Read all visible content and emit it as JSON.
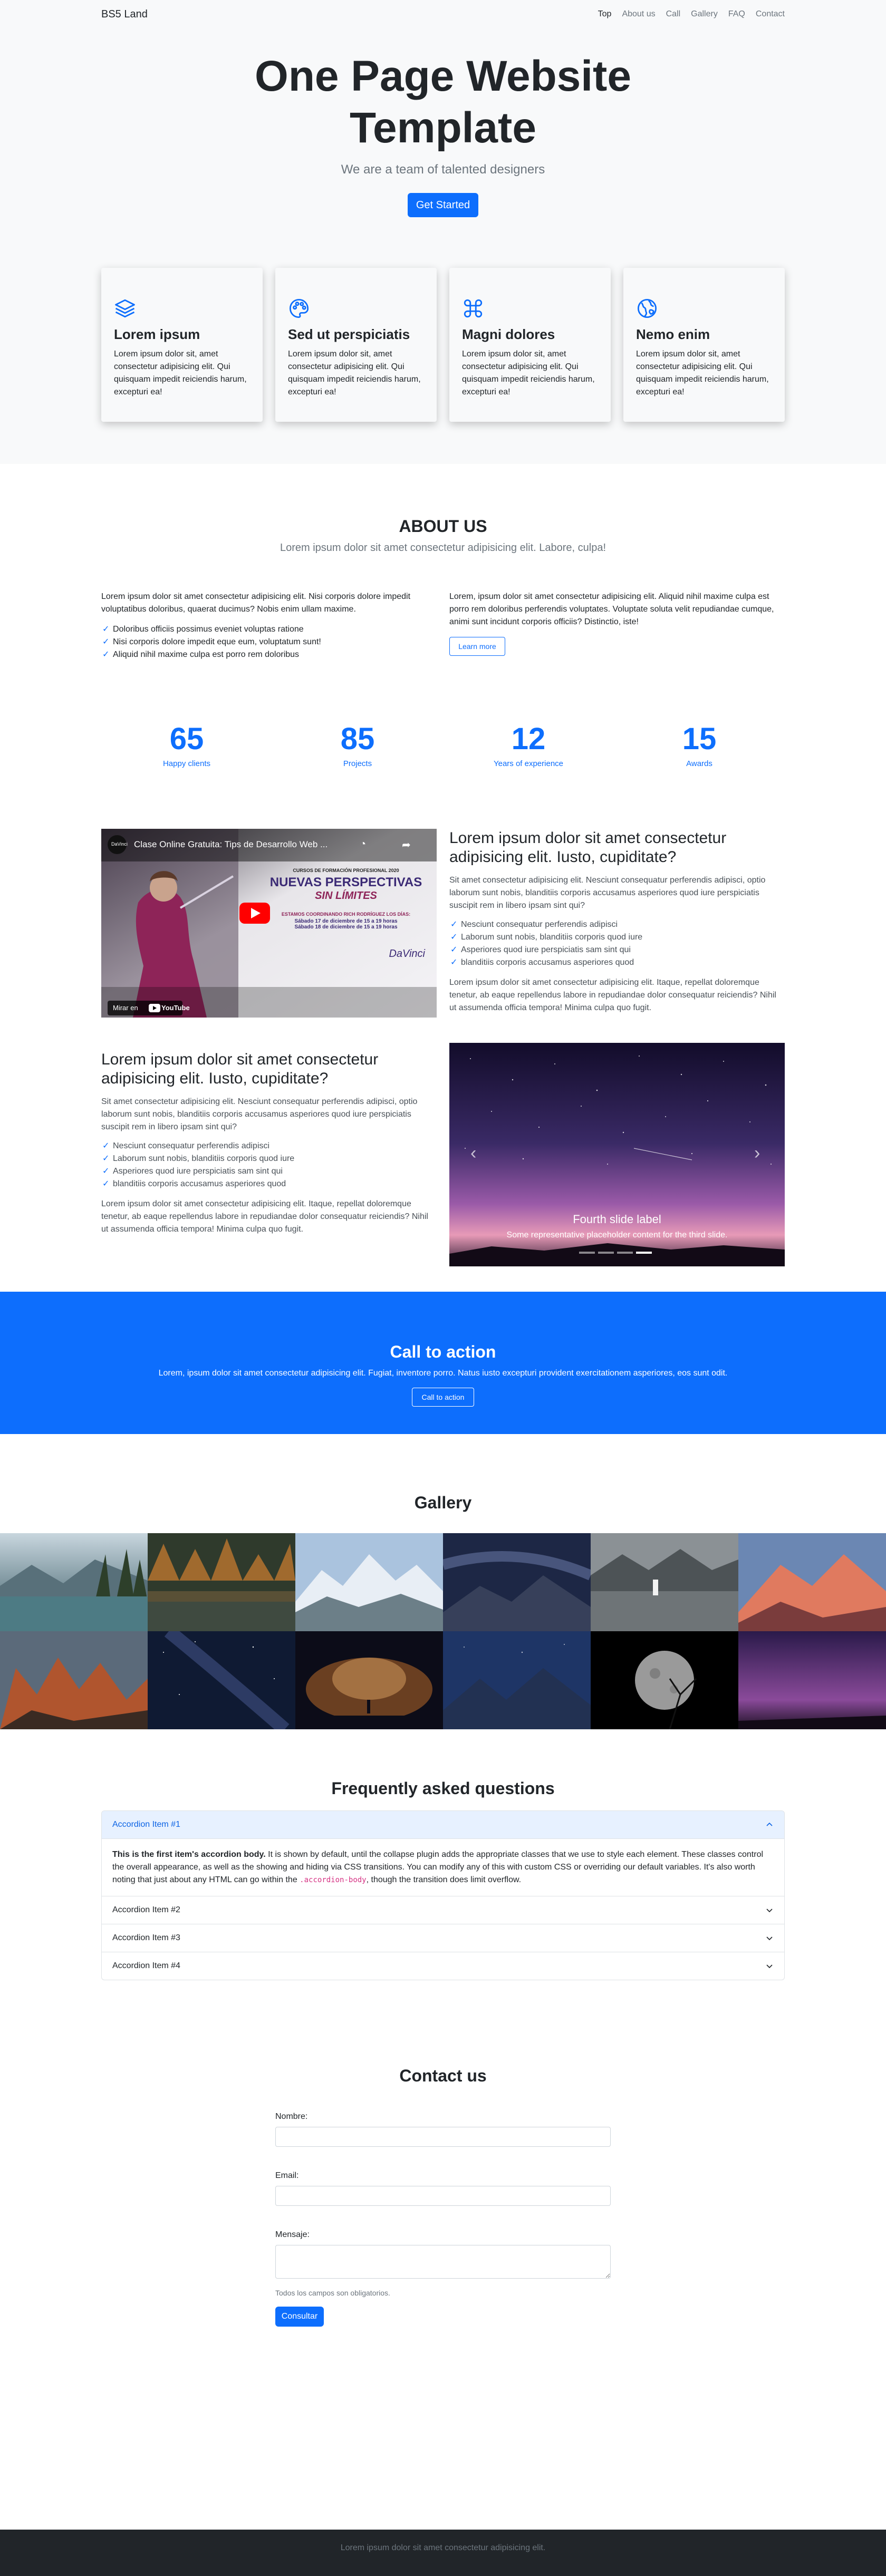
{
  "nav": {
    "brand": "BS5 Land",
    "links": [
      "Top",
      "About us",
      "Call",
      "Gallery",
      "FAQ",
      "Contact"
    ]
  },
  "hero": {
    "title": "One Page Website Template",
    "subtitle": "We are a team of talented designers",
    "button": "Get Started"
  },
  "features": [
    {
      "icon": "layers-icon",
      "title": "Lorem ipsum",
      "text": "Lorem ipsum dolor sit, amet consectetur adipisicing elit. Qui quisquam impedit reiciendis harum, excepturi ea!"
    },
    {
      "icon": "palette-icon",
      "title": "Sed ut perspiciatis",
      "text": "Lorem ipsum dolor sit, amet consectetur adipisicing elit. Qui quisquam impedit reiciendis harum, excepturi ea!"
    },
    {
      "icon": "command-icon",
      "title": "Magni dolores",
      "text": "Lorem ipsum dolor sit, amet consectetur adipisicing elit. Qui quisquam impedit reiciendis harum, excepturi ea!"
    },
    {
      "icon": "globe-icon",
      "title": "Nemo enim",
      "text": "Lorem ipsum dolor sit, amet consectetur adipisicing elit. Qui quisquam impedit reiciendis harum, excepturi ea!"
    }
  ],
  "about": {
    "title": "ABOUT US",
    "lead": "Lorem ipsum dolor sit amet consectetur adipisicing elit. Labore, culpa!",
    "left_text": "Lorem ipsum dolor sit amet consectetur adipisicing elit. Nisi corporis dolore impedit voluptatibus doloribus, quaerat ducimus? Nobis enim ullam maxime.",
    "left_checks": [
      "Doloribus officiis possimus eveniet voluptas ratione",
      "Nisi corporis dolore impedit eque eum, voluptatum sunt!",
      "Aliquid nihil maxime culpa est porro rem doloribus"
    ],
    "right_text": "Lorem, ipsum dolor sit amet consectetur adipisicing elit. Aliquid nihil maxime culpa est porro rem doloribus perferendis voluptates. Voluptate soluta velit repudiandae cumque, animi sunt incidunt corporis officiis? Distinctio, iste!",
    "learn_more": "Learn more"
  },
  "stats": [
    {
      "value": "65",
      "label": "Happy clients"
    },
    {
      "value": "85",
      "label": "Projects"
    },
    {
      "value": "12",
      "label": "Years of experience"
    },
    {
      "value": "15",
      "label": "Awards"
    }
  ],
  "video": {
    "channel": "DaVinci",
    "title": "Clase Online Gratuita: Tips de Desarrollo Web ...",
    "watch_label": "Mirar en",
    "platform": "YouTube",
    "poster_header": "CURSOS DE FORMACIÓN PROFESIONAL 2020",
    "poster_title": "NUEVAS PERSPECTIVAS",
    "poster_subtitle": "SIN LÍMITES",
    "poster_line1": "ESTAMOS COORDINANDO RICH RODRÍGUEZ LOS DÍAS:",
    "poster_line2": "Sábado 17 de diciembre de 15 a 19 horas",
    "poster_line3": "Sábado 18 de diciembre de 15 a 19 horas",
    "poster_brand": "DaVinci"
  },
  "row1": {
    "heading": "Lorem ipsum dolor sit amet consectetur adipisicing elit. Iusto, cupiditate?",
    "text1": "Sit amet consectetur adipisicing elit. Nesciunt consequatur perferendis adipisci, optio laborum sunt nobis, blanditiis corporis accusamus asperiores quod iure perspiciatis suscipit rem in libero ipsam sint qui?",
    "checks": [
      "Nesciunt consequatur perferendis adipisci",
      "Laborum sunt nobis, blanditiis corporis quod iure",
      "Asperiores quod iure perspiciatis sam sint qui",
      "blanditiis corporis accusamus asperiores quod"
    ],
    "text2": "Lorem ipsum dolor sit amet consectetur adipisicing elit. Itaque, repellat doloremque tenetur, ab eaque repellendus labore in repudiandae dolor consequatur reiciendis? Nihil ut assumenda officia tempora! Minima culpa quo fugit."
  },
  "row2": {
    "heading": "Lorem ipsum dolor sit amet consectetur adipisicing elit. Iusto, cupiditate?",
    "text1": "Sit amet consectetur adipisicing elit. Nesciunt consequatur perferendis adipisci, optio laborum sunt nobis, blanditiis corporis accusamus asperiores quod iure perspiciatis suscipit rem in libero ipsam sint qui?",
    "checks": [
      "Nesciunt consequatur perferendis adipisci",
      "Laborum sunt nobis, blanditiis corporis quod iure",
      "Asperiores quod iure perspiciatis sam sint qui",
      "blanditiis corporis accusamus asperiores quod"
    ],
    "text2": "Lorem ipsum dolor sit amet consectetur adipisicing elit. Itaque, repellat doloremque tenetur, ab eaque repellendus labore in repudiandae dolor consequatur reiciendis? Nihil ut assumenda officia tempora! Minima culpa quo fugit."
  },
  "carousel": {
    "caption_title": "Fourth slide label",
    "caption_text": "Some representative placeholder content for the third slide.",
    "slides": 4,
    "active_slide": 4
  },
  "cta": {
    "title": "Call to action",
    "text": "Lorem, ipsum dolor sit amet consectetur adipisicing elit. Fugiat, inventore porro. Natus iusto excepturi provident exercitationem asperiores, eos sunt odit.",
    "button": "Call to action"
  },
  "gallery": {
    "title": "Gallery",
    "tiles": [
      "lake-forest",
      "autumn-lake",
      "snowy-mountains",
      "milky-way-mountain",
      "misty-lake",
      "pink-peaks",
      "orange-rocks",
      "starry-night",
      "galaxy-silhouette",
      "night-peaks",
      "moon-branch",
      "purple-sky"
    ]
  },
  "faq": {
    "title": "Frequently asked questions",
    "items": [
      "Accordion Item #1",
      "Accordion Item #2",
      "Accordion Item #3",
      "Accordion Item #4"
    ],
    "body_strong": "This is the first item's accordion body.",
    "body_text": " It is shown by default, until the collapse plugin adds the appropriate classes that we use to style each element. These classes control the overall appearance, as well as the showing and hiding via CSS transitions. You can modify any of this with custom CSS or overriding our default variables. It's also worth noting that just about any HTML can go within the ",
    "body_code": ".accordion-body",
    "body_end": ", though the transition does limit overflow."
  },
  "contact": {
    "title": "Contact us",
    "name_label": "Nombre:",
    "email_label": "Email:",
    "message_label": "Mensaje:",
    "help": "Todos los campos son obligatorios.",
    "submit": "Consultar"
  },
  "footer": {
    "text": "Lorem ipsum dolor sit amet consectetur adipisicing elit."
  },
  "colors": {
    "primary": "#0d6efd",
    "light": "#f8f9fa",
    "dark": "#212529",
    "muted": "#6c757d"
  }
}
